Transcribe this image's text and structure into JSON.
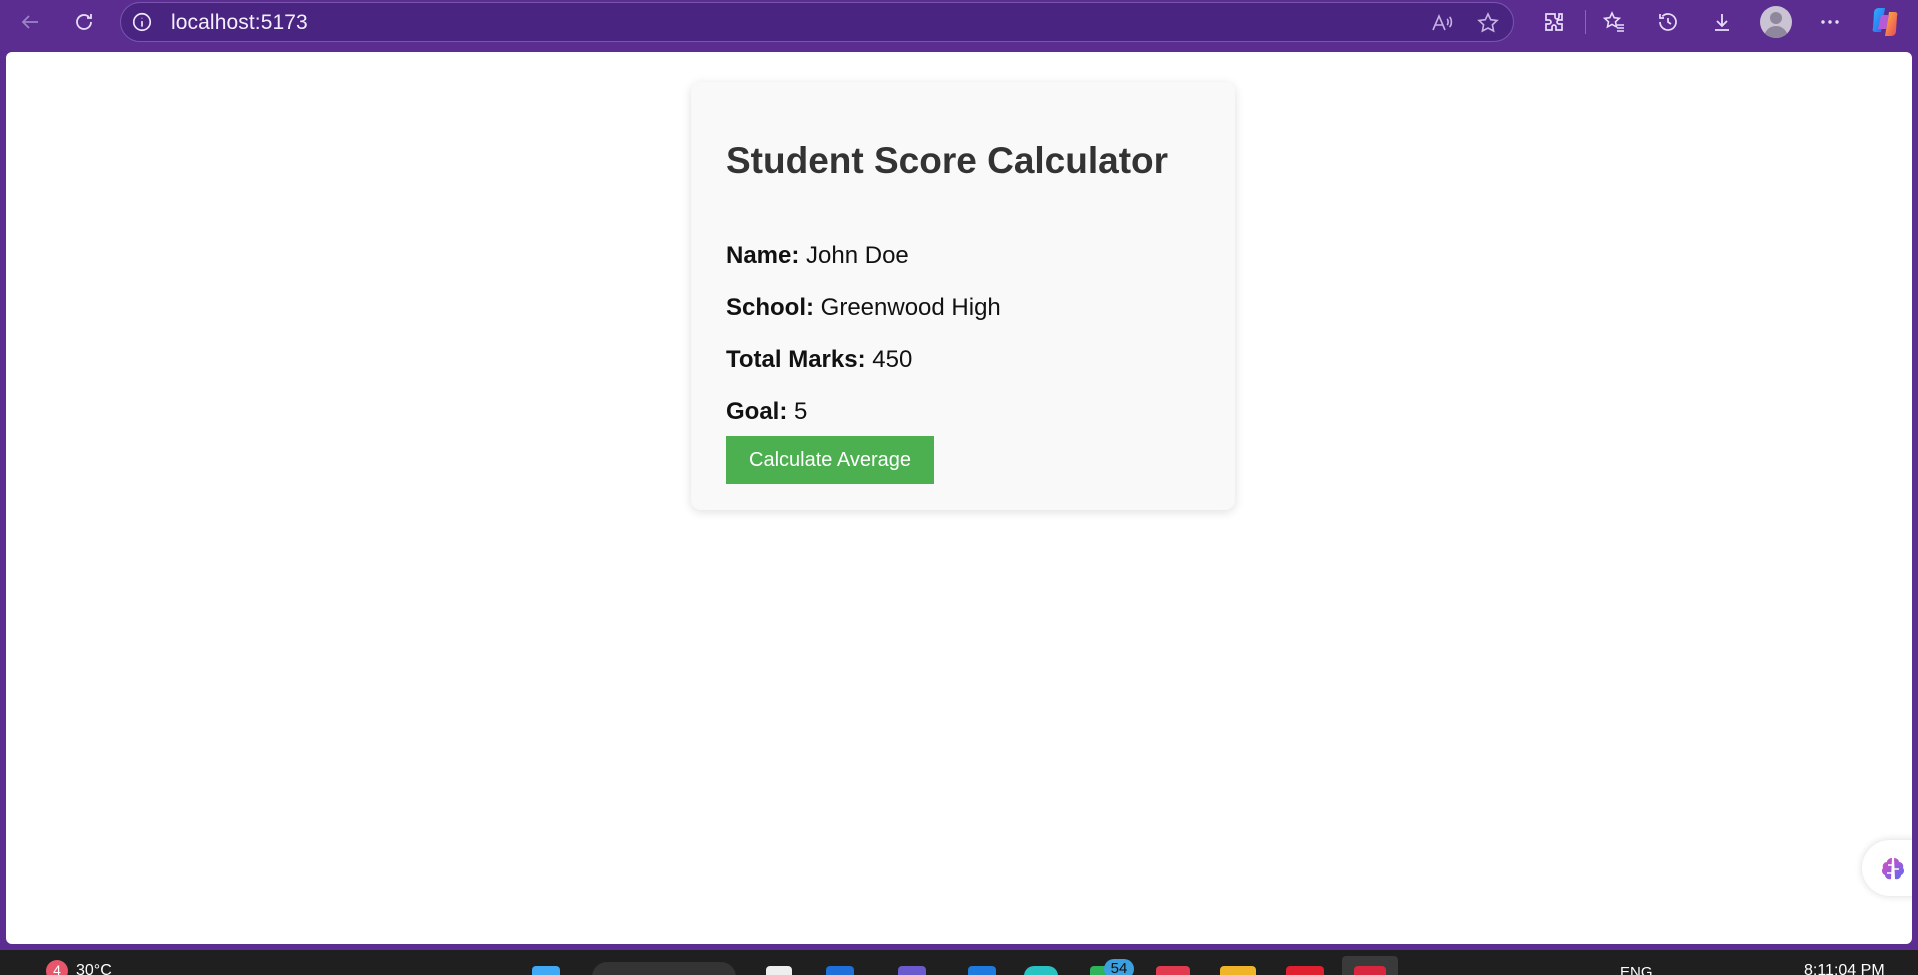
{
  "browser": {
    "url": "localhost:5173",
    "icons": {
      "back": "back-arrow-icon",
      "refresh": "refresh-icon",
      "info": "site-info-icon",
      "read_aloud": "read-aloud-icon",
      "favorite": "star-icon",
      "extensions": "extensions-icon",
      "favorites": "favorites-icon",
      "history": "history-icon",
      "downloads": "download-icon",
      "profile": "profile-avatar",
      "more": "more-icon",
      "copilot": "copilot-icon"
    },
    "theme_color": "#5b2d91"
  },
  "card": {
    "title": "Student Score Calculator",
    "rows": [
      {
        "label": "Name:",
        "value": "John Doe"
      },
      {
        "label": "School:",
        "value": "Greenwood High"
      },
      {
        "label": "Total Marks:",
        "value": "450"
      },
      {
        "label": "Goal:",
        "value": "5"
      }
    ],
    "button_label": "Calculate Average",
    "button_color": "#4caf50"
  },
  "taskbar": {
    "weather_badge": "4",
    "weather_temp": "30°C",
    "notification_badge": "54",
    "language": "ENG",
    "time": "8:11:04 PM"
  }
}
